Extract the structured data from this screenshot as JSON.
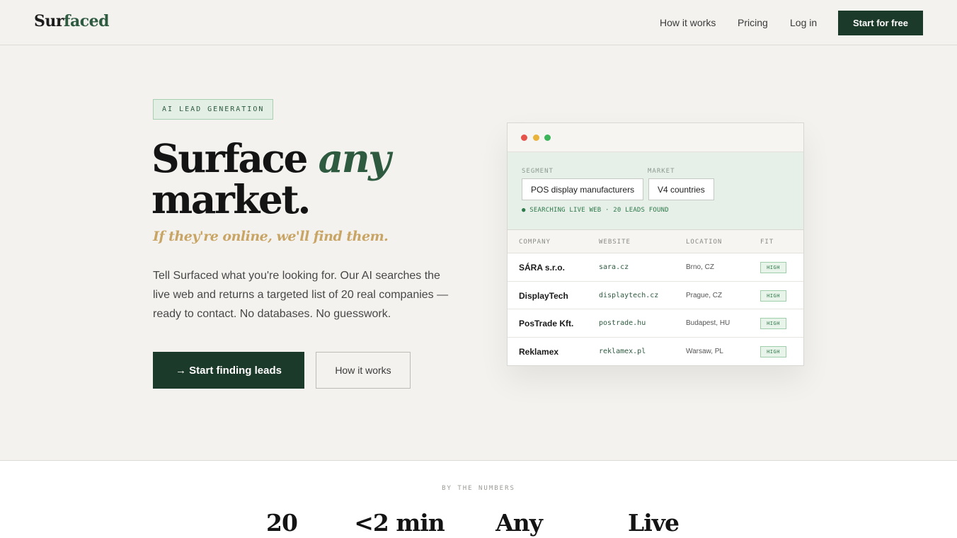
{
  "nav": {
    "logo_main": "Sur",
    "logo_accent": "faced",
    "links": [
      "How it works",
      "Pricing",
      "Log in"
    ],
    "cta": "Start for free"
  },
  "hero": {
    "badge": "AI LEAD GENERATION",
    "headline_1": "Surface",
    "headline_em": "any",
    "headline_2": "market.",
    "tagline": "If they're online, we'll find them.",
    "description": "Tell Surfaced what you're looking for. Our AI searches the live web and returns a targeted list of 20 real companies — ready to contact. No databases. No guesswork.",
    "primary_button": "→ Start finding leads",
    "secondary_button": "How it works"
  },
  "demo": {
    "window_dots": [
      "#e5534b",
      "#e9b23a",
      "#3cb55a"
    ],
    "segment_label": "SEGMENT",
    "segment_value": "POS display manufacturers",
    "market_label": "MARKET",
    "market_value": "V4 countries",
    "status": "● SEARCHING LIVE WEB · 20 LEADS FOUND",
    "columns": [
      "COMPANY",
      "WEBSITE",
      "LOCATION",
      "FIT"
    ],
    "rows": [
      {
        "company": "SÁRA s.r.o.",
        "website": "sara.cz",
        "location": "Brno, CZ",
        "fit": "HIGH"
      },
      {
        "company": "DisplayTech",
        "website": "displaytech.cz",
        "location": "Prague, CZ",
        "fit": "HIGH"
      },
      {
        "company": "PosTrade Kft.",
        "website": "postrade.hu",
        "location": "Budapest, HU",
        "fit": "HIGH"
      },
      {
        "company": "Reklamex",
        "website": "reklamex.pl",
        "location": "Warsaw, PL",
        "fit": "HIGH"
      }
    ]
  },
  "numbers": {
    "label": "BY THE NUMBERS",
    "stats": [
      "20",
      "<2 min",
      "Any",
      "Live"
    ]
  },
  "colors": {
    "brand_green": "#1c3a2a",
    "accent_green": "#2e5a40",
    "gold": "#c9a565",
    "background": "#f3f2ee"
  }
}
